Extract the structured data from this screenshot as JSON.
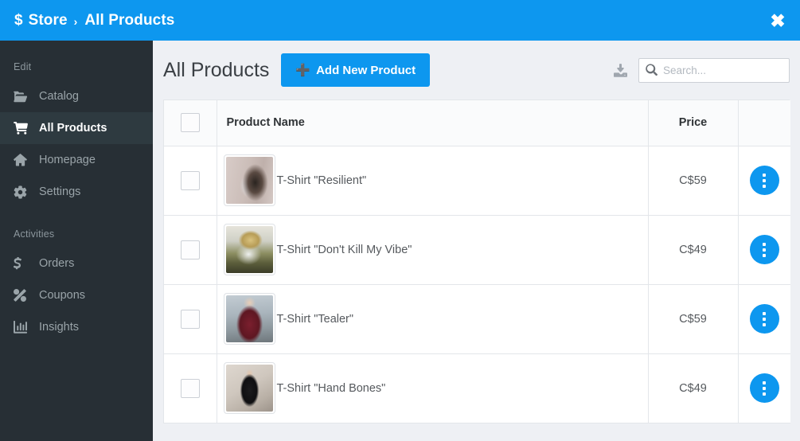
{
  "topbar": {
    "brand_icon": "dollar-sign-icon",
    "brand_label": "Store",
    "separator": "›",
    "current_label": "All Products",
    "close_label": "✖",
    "accent_color": "#0d97ef"
  },
  "sidebar": {
    "background_color": "#272f35",
    "active_color": "#2e3a40",
    "groups": [
      {
        "label": "Edit",
        "items": [
          {
            "label": "Catalog",
            "icon": "folder-open-icon",
            "active": false
          },
          {
            "label": "All Products",
            "icon": "shopping-cart-icon",
            "active": true
          },
          {
            "label": "Homepage",
            "icon": "home-icon",
            "active": false
          },
          {
            "label": "Settings",
            "icon": "gear-icon",
            "active": false
          }
        ]
      },
      {
        "label": "Activities",
        "items": [
          {
            "label": "Orders",
            "icon": "dollar-sign-icon",
            "active": false
          },
          {
            "label": "Coupons",
            "icon": "percent-icon",
            "active": false
          },
          {
            "label": "Insights",
            "icon": "bar-chart-icon",
            "active": false
          }
        ]
      }
    ]
  },
  "main": {
    "page_title": "All Products",
    "add_button": {
      "label": "Add New Product",
      "icon": "plus-icon"
    },
    "export_icon": "download-icon",
    "search": {
      "placeholder": "Search...",
      "value": "",
      "icon": "search-icon"
    }
  },
  "table": {
    "columns": [
      {
        "key": "checkbox",
        "label": ""
      },
      {
        "key": "name",
        "label": "Product Name"
      },
      {
        "key": "price",
        "label": "Price"
      },
      {
        "key": "actions",
        "label": ""
      }
    ],
    "select_all_checked": false,
    "rows": [
      {
        "checked": false,
        "name": "T-Shirt \"Resilient\"",
        "price": "C$59",
        "action_icon": "ellipsis-vertical-icon"
      },
      {
        "checked": false,
        "name": "T-Shirt \"Don't Kill My Vibe\"",
        "price": "C$49",
        "action_icon": "ellipsis-vertical-icon"
      },
      {
        "checked": false,
        "name": "T-Shirt \"Tealer\"",
        "price": "C$59",
        "action_icon": "ellipsis-vertical-icon"
      },
      {
        "checked": false,
        "name": "T-Shirt \"Hand Bones\"",
        "price": "C$49",
        "action_icon": "ellipsis-vertical-icon"
      }
    ]
  }
}
